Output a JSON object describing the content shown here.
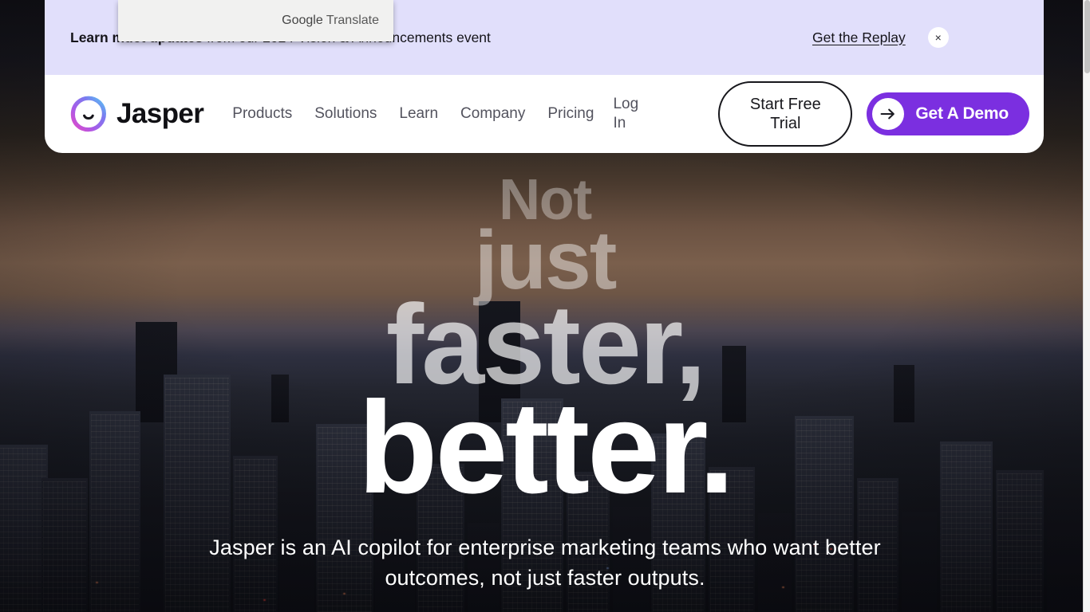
{
  "banner": {
    "text_lead": "Learn m",
    "text_bold_tail": "uct updates",
    "text_rest": " from our 2024 Vision & Announcements event",
    "full_text": "Learn more about our latest product updates from our 2024 Vision & Announcements event",
    "link_label": "Get the Replay",
    "close_label": "×",
    "bg_color": "#E1DFFB"
  },
  "nav": {
    "brand": "Jasper",
    "links": [
      {
        "label": "Products"
      },
      {
        "label": "Solutions"
      },
      {
        "label": "Learn"
      },
      {
        "label": "Company"
      },
      {
        "label": "Pricing"
      },
      {
        "label": "Log In"
      }
    ],
    "trial_button": "Start Free Trial",
    "demo_button": "Get A Demo",
    "demo_button_color": "#7B2FE0"
  },
  "hero": {
    "line1": "Not",
    "line2": "just",
    "line3": "faster,",
    "line4": "better.",
    "subtitle": "Jasper is an AI copilot for enterprise marketing teams who want better outcomes, not just faster outputs."
  },
  "overlay": {
    "google_translate_brand": "Google",
    "google_translate_word": "Translate"
  }
}
